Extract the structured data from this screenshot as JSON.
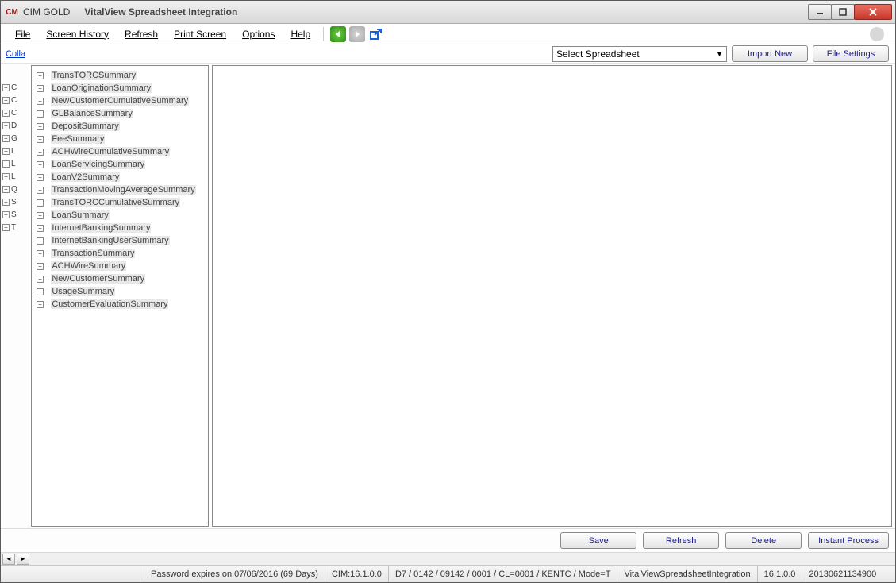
{
  "titlebar": {
    "app_icon_text": "CM",
    "app_name": "CIM GOLD",
    "page_title": "VitalView Spreadsheet Integration"
  },
  "menu": {
    "file": "File",
    "screen_history": "Screen History",
    "refresh": "Refresh",
    "print_screen": "Print Screen",
    "options": "Options",
    "help": "Help"
  },
  "toolbar": {
    "collapse": "Colla",
    "dropdown_selected": "Select Spreadsheet",
    "import_new": "Import New",
    "file_settings": "File Settings"
  },
  "gutter_items": [
    "C",
    "C",
    "C",
    "D",
    "G",
    "L",
    "L",
    "L",
    "Q",
    "S",
    "S",
    "T"
  ],
  "tree_items": [
    "TransTORCSummary",
    "LoanOriginationSummary",
    "NewCustomerCumulativeSummary",
    "GLBalanceSummary",
    "DepositSummary",
    "FeeSummary",
    "ACHWireCumulativeSummary",
    "LoanServicingSummary",
    "LoanV2Summary",
    "TransactionMovingAverageSummary",
    "TransTORCCumulativeSummary",
    "LoanSummary",
    "InternetBankingSummary",
    "InternetBankingUserSummary",
    "TransactionSummary",
    "ACHWireSummary",
    "NewCustomerSummary",
    "UsageSummary",
    "CustomerEvaluationSummary"
  ],
  "buttons": {
    "save": "Save",
    "refresh": "Refresh",
    "delete": "Delete",
    "instant_process": "Instant Process"
  },
  "status": {
    "password": "Password expires on 07/06/2016 (69 Days)",
    "cim": "CIM:16.1.0.0",
    "conn": "D7 / 0142 / 09142 / 0001 / CL=0001 / KENTC / Mode=T",
    "screen": "VitalViewSpreadsheetIntegration",
    "ver": "16.1.0.0",
    "build": "20130621134900"
  }
}
